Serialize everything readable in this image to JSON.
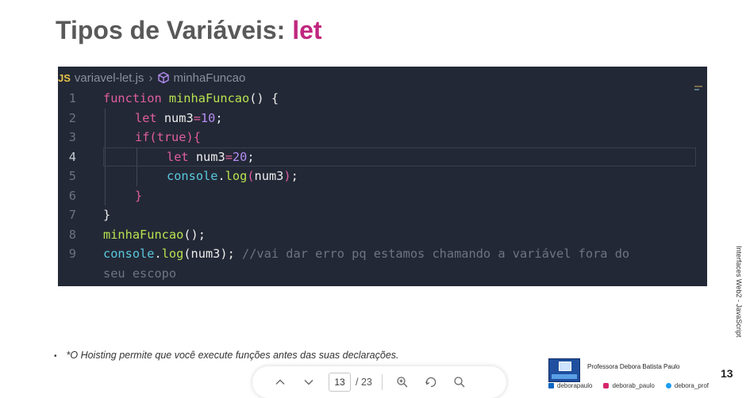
{
  "slide": {
    "title_main": "Tipos de Variáveis: ",
    "title_highlight": "let",
    "side_text": "Interfaces Web2 - JavaScript",
    "note": "*O Hoisting permite que você execute funções antes das suas declarações.",
    "bullet": "•",
    "page_number": "13",
    "professor": "Professora Debora Batista Paulo",
    "socials": {
      "linkedin": "deborapaulo",
      "instagram": "deborab_paulo",
      "twitter": "debora_prof"
    }
  },
  "editor": {
    "breadcrumb": {
      "lang_badge": "JS",
      "file": "variavel-let.js",
      "symbol": "minhaFuncao"
    },
    "current_line": 4,
    "lines": [
      {
        "n": "1",
        "indent": 0,
        "tokens": [
          [
            "kw",
            "function "
          ],
          [
            "fn",
            "minhaFuncao"
          ],
          [
            "pl",
            "() {"
          ]
        ]
      },
      {
        "n": "2",
        "indent": 1,
        "tokens": [
          [
            "kw",
            "let "
          ],
          [
            "vr",
            "num3"
          ],
          [
            "kw",
            "="
          ],
          [
            "num",
            "10"
          ],
          [
            "pl",
            ";"
          ]
        ]
      },
      {
        "n": "3",
        "indent": 1,
        "tokens": [
          [
            "kw",
            "if"
          ],
          [
            "br",
            "("
          ],
          [
            "kw",
            "true"
          ],
          [
            "br",
            "){"
          ]
        ]
      },
      {
        "n": "4",
        "indent": 2,
        "tokens": [
          [
            "kw",
            "let "
          ],
          [
            "vr",
            "num3"
          ],
          [
            "kw",
            "="
          ],
          [
            "num",
            "20"
          ],
          [
            "pl",
            ";"
          ]
        ]
      },
      {
        "n": "5",
        "indent": 2,
        "tokens": [
          [
            "obj",
            "console"
          ],
          [
            "pl",
            "."
          ],
          [
            "fn",
            "log"
          ],
          [
            "br",
            "("
          ],
          [
            "vr",
            "num3"
          ],
          [
            "br",
            ")"
          ],
          [
            "pl",
            ";"
          ]
        ]
      },
      {
        "n": "6",
        "indent": 1,
        "tokens": [
          [
            "br",
            "}"
          ]
        ]
      },
      {
        "n": "7",
        "indent": 0,
        "tokens": [
          [
            "pl",
            "}"
          ]
        ]
      },
      {
        "n": "8",
        "indent": 0,
        "tokens": [
          [
            "fn",
            "minhaFuncao"
          ],
          [
            "pl",
            "();"
          ]
        ]
      },
      {
        "n": "9",
        "indent": 0,
        "tokens": [
          [
            "obj",
            "console"
          ],
          [
            "pl",
            "."
          ],
          [
            "fn",
            "log"
          ],
          [
            "pl",
            "(num3); "
          ],
          [
            "cm",
            "//vai dar erro pq estamos chamando a variável fora do"
          ]
        ]
      },
      {
        "n": "",
        "indent": 0,
        "tokens": [
          [
            "cm",
            "seu escopo"
          ]
        ]
      }
    ]
  },
  "viewer": {
    "current_page": "13",
    "total_pages": "/ 23",
    "icons": [
      "chevron-up-icon",
      "chevron-down-icon",
      "zoom-in-icon",
      "rotate-icon",
      "search-icon"
    ]
  }
}
